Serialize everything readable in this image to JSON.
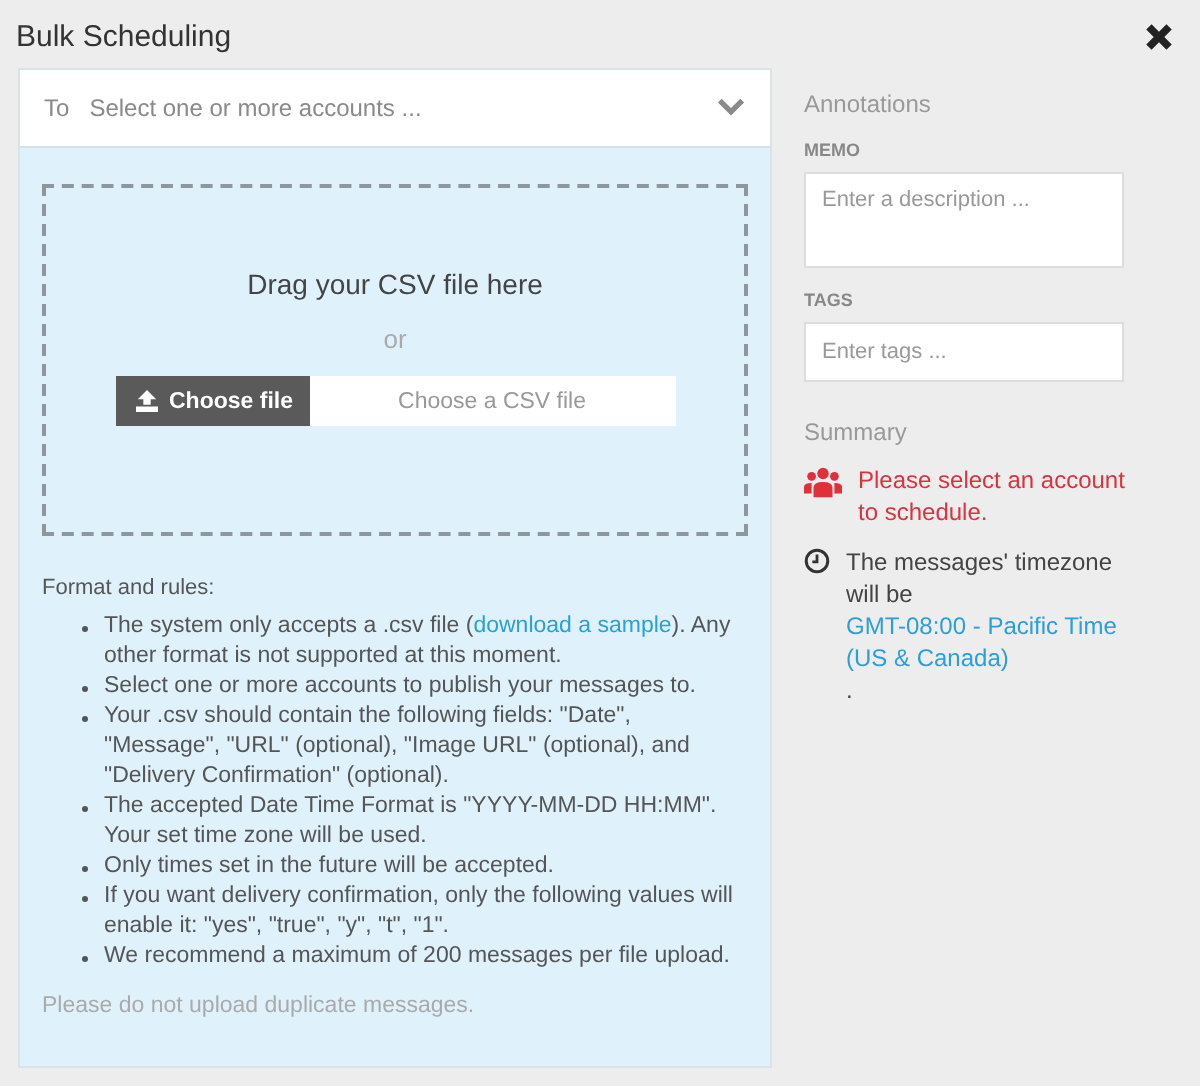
{
  "window": {
    "title": "Bulk Scheduling"
  },
  "recipients": {
    "label": "To",
    "placeholder": "Select one or more accounts ..."
  },
  "dropzone": {
    "heading": "Drag your CSV file here",
    "separator": "or",
    "button": "Choose file",
    "file_placeholder": "Choose a CSV file"
  },
  "rules": {
    "title": "Format and rules:",
    "items": [
      {
        "text": "The system only accepts a .csv file (",
        "link": "download a sample",
        "after": "). Any other format is not supported at this moment."
      },
      {
        "text": "Select one or more accounts to publish your messages to."
      },
      {
        "text": "Your .csv should contain the following fields: \"Date\", \"Message\", \"URL\" (optional), \"Image URL\" (optional), and \"Delivery Confirmation\" (optional)."
      },
      {
        "text": "The accepted Date Time Format is \"YYYY-MM-DD HH:MM\". Your set time zone will be used."
      },
      {
        "text": "Only times set in the future will be accepted."
      },
      {
        "text": "If you want delivery confirmation, only the following values will enable it: \"yes\", \"true\", \"y\", \"t\", \"1\"."
      },
      {
        "text": "We recommend a maximum of 200 messages per file upload."
      }
    ],
    "note": "Please do not upload duplicate messages."
  },
  "annotations": {
    "title": "Annotations",
    "memo_label": "MEMO",
    "memo_placeholder": "Enter a description ...",
    "tags_label": "TAGS",
    "tags_placeholder": "Enter tags ..."
  },
  "summary": {
    "title": "Summary",
    "items": [
      {
        "kind": "error",
        "text": "Please select an account to schedule."
      },
      {
        "kind": "info",
        "text": "The messages' timezone will be ",
        "link": "GMT-08:00 - Pacific Time (US & Canada)",
        "after": "."
      }
    ]
  }
}
